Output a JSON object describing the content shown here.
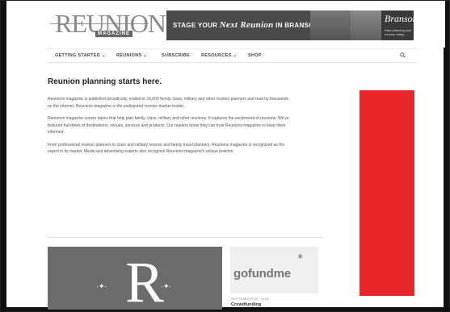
{
  "logo": {
    "word": "REUNIONS",
    "sub": "MAGAZINE"
  },
  "banner": {
    "text_lead": "STAGE YOUR",
    "text_italic": "Next Reunion",
    "text_tail": "IN BRANSON.",
    "brand": "Branson",
    "brand_sub": "Start planning your reunion today."
  },
  "nav": {
    "items": [
      "GETTING STARTED ⌄",
      "REUNIONS ⌄",
      "SUBSCRIBE",
      "RESOURCES ⌄",
      "SHOP"
    ],
    "search_icon": "search-icon"
  },
  "main": {
    "title": "Reunion planning starts here.",
    "paragraphs": [
      "Reunions magazine is published periodically, mailed to 15,000 family, class, military and other reunion planners and read by thousands on the internet. Reunions magazine is the undisputed reunion market leader.",
      "Reunions magazine covers topics that help plan family, class, military and other reunions. It captures the excitement of reunions. We've featured hundreds of destinations, venues, services and products. Our readers know they can trust Reunions magazine to keep them informed.",
      "From professional reunion planners to class and military reunion and family travel planners, Reunions magazine is recognized as the expert in its market. Media and advertising experts also recognize Reunions magazine's unique position."
    ]
  },
  "feature": {
    "letter": "R"
  },
  "post": {
    "logo_text": "gofundme",
    "date": "SEPTEMBER 20, 2016",
    "title": "Crowdfunding"
  },
  "colors": {
    "ad": "#e9262a",
    "feature_bg": "#6c6c6c"
  }
}
